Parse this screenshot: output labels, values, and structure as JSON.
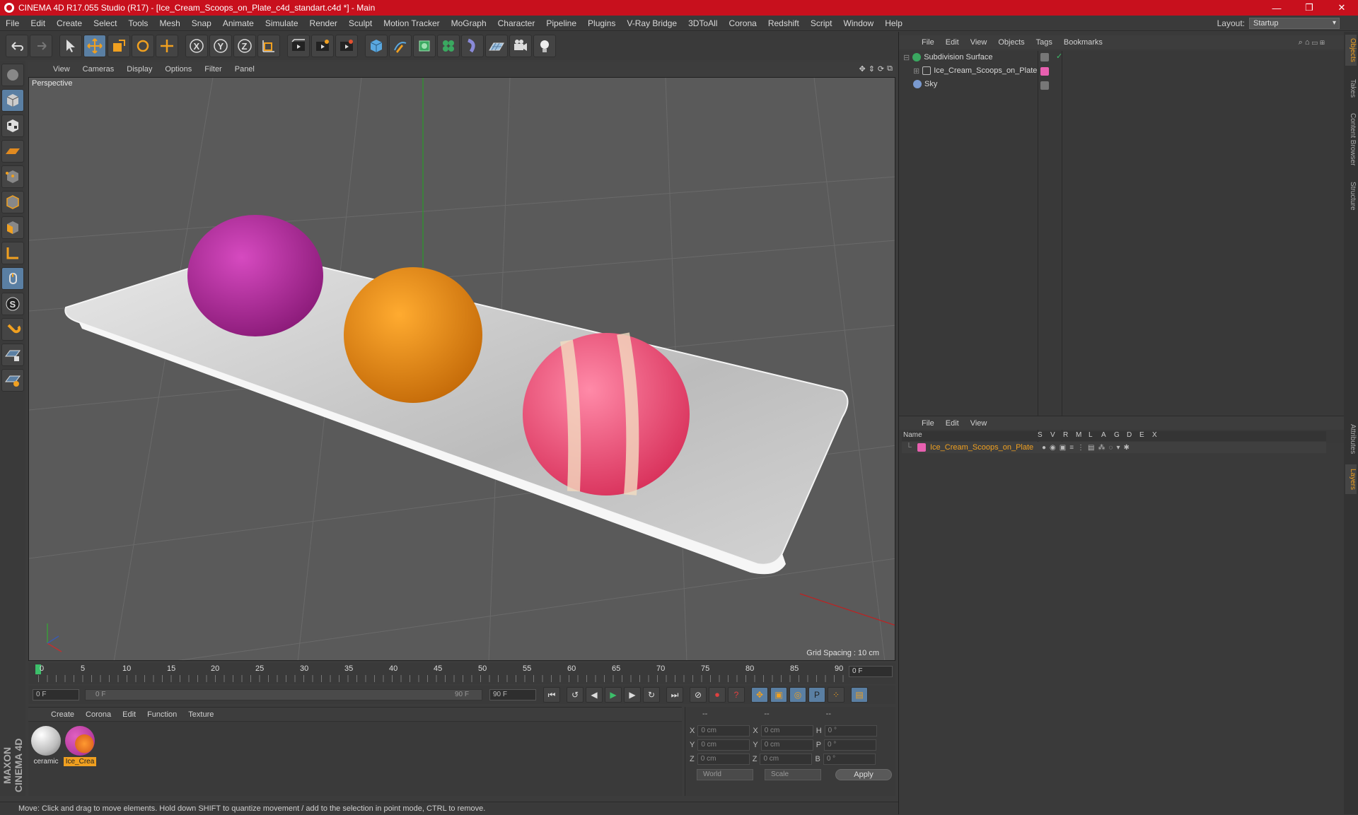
{
  "window": {
    "title": "CINEMA 4D R17.055 Studio (R17) - [Ice_Cream_Scoops_on_Plate_c4d_standart.c4d *] - Main",
    "controls": [
      "—",
      "❐",
      "✕"
    ]
  },
  "menubar": [
    "File",
    "Edit",
    "Create",
    "Select",
    "Tools",
    "Mesh",
    "Snap",
    "Animate",
    "Simulate",
    "Render",
    "Sculpt",
    "Motion Tracker",
    "MoGraph",
    "Character",
    "Pipeline",
    "Plugins",
    "V-Ray Bridge",
    "3DToAll",
    "Corona",
    "Redshift",
    "Script",
    "Window",
    "Help"
  ],
  "layout": {
    "label": "Layout:",
    "value": "Startup"
  },
  "viewport": {
    "menu": [
      "View",
      "Cameras",
      "Display",
      "Options",
      "Filter",
      "Panel"
    ],
    "label": "Perspective",
    "grid_spacing": "Grid Spacing : 10 cm"
  },
  "timeline": {
    "ticks": [
      "0",
      "5",
      "10",
      "15",
      "20",
      "25",
      "30",
      "35",
      "40",
      "45",
      "50",
      "55",
      "60",
      "65",
      "70",
      "75",
      "80",
      "85",
      "90"
    ],
    "current_frame": "0 F"
  },
  "transport": {
    "start": "0 F",
    "slider_left": "0 F",
    "slider_right": "90 F",
    "end": "90 F"
  },
  "materials": {
    "menu": [
      "Create",
      "Corona",
      "Edit",
      "Function",
      "Texture"
    ],
    "items": [
      {
        "name": "ceramic"
      },
      {
        "name": "Ice_Crea"
      }
    ]
  },
  "coordinates": {
    "headers": [
      "--",
      "--",
      "--"
    ],
    "rows": [
      {
        "a": "X",
        "av": "0 cm",
        "b": "X",
        "bv": "0 cm",
        "c": "H",
        "cv": "0 °"
      },
      {
        "a": "Y",
        "av": "0 cm",
        "b": "Y",
        "bv": "0 cm",
        "c": "P",
        "cv": "0 °"
      },
      {
        "a": "Z",
        "av": "0 cm",
        "b": "Z",
        "bv": "0 cm",
        "c": "B",
        "cv": "0 °"
      }
    ],
    "mode": "World",
    "scale": "Scale",
    "apply": "Apply"
  },
  "status": "Move: Click and drag to move elements. Hold down SHIFT to quantize movement / add to the selection in point mode, CTRL to remove.",
  "objects": {
    "menu": [
      "File",
      "Edit",
      "View",
      "Objects",
      "Tags",
      "Bookmarks"
    ],
    "items": [
      {
        "name": "Subdivision Surface"
      },
      {
        "name": "Ice_Cream_Scoops_on_Plate"
      },
      {
        "name": "Sky"
      }
    ]
  },
  "layers": {
    "menu": [
      "File",
      "Edit",
      "View"
    ],
    "columns": [
      "Name",
      "S",
      "V",
      "R",
      "M",
      "L",
      "A",
      "G",
      "D",
      "E",
      "X"
    ],
    "row": "Ice_Cream_Scoops_on_Plate"
  },
  "side_tabs": [
    "Objects",
    "Takes",
    "Content Browser",
    "Structure",
    "Attributes",
    "Layers"
  ],
  "brand": "MAXON CINEMA 4D"
}
